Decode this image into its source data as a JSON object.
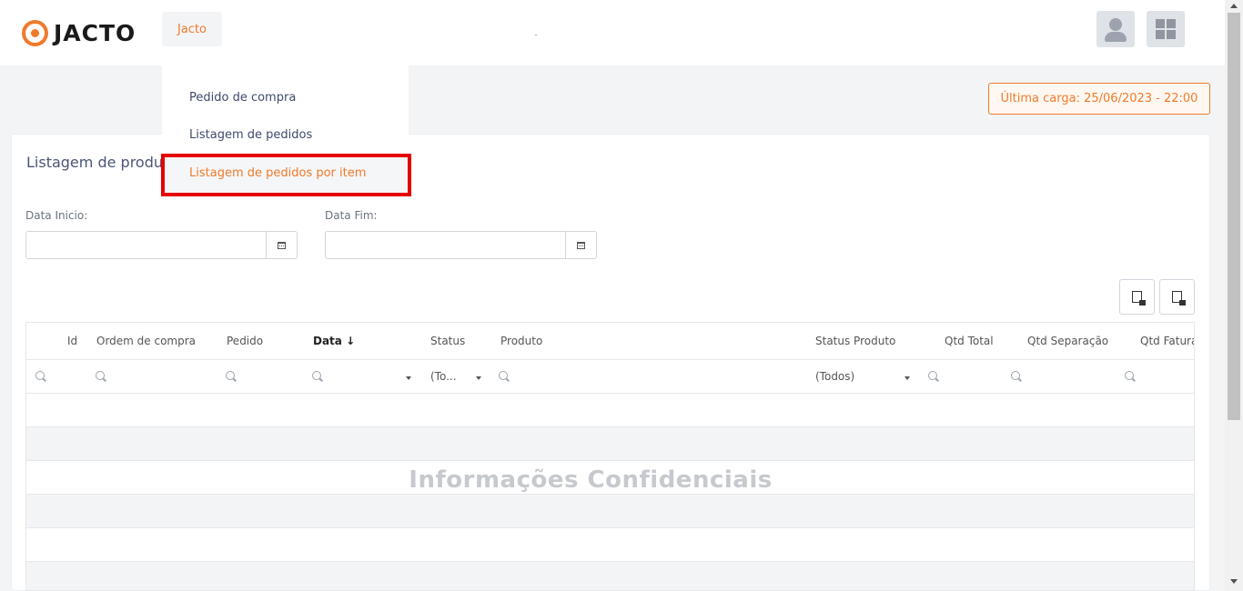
{
  "header": {
    "logo_text": "JACTO",
    "nav_label": "Jacto",
    "icons": [
      "user-icon",
      "apps-grid-icon"
    ]
  },
  "dropdown": {
    "items": [
      {
        "label": "Pedido de compra"
      },
      {
        "label": "Listagem de pedidos"
      },
      {
        "label": "Listagem de pedidos por item"
      }
    ]
  },
  "last_load": "Última carga: 25/06/2023 - 22:00",
  "page_title": "Listagem de produ",
  "filters": {
    "start_label": "Data Inicio:",
    "end_label": "Data Fim:",
    "start_value": "",
    "end_value": ""
  },
  "grid": {
    "columns": [
      "Id",
      "Ordem de compra",
      "Pedido",
      "Data ↓",
      "Status",
      "Produto",
      "Status Produto",
      "Qtd Total",
      "Qtd Separação",
      "Qtd Fatura"
    ],
    "status_filter": "(To...",
    "status_produto_filter": "(Todos)"
  },
  "watermark": "Informações Confidenciais",
  "colors": {
    "accent": "#f07a2a",
    "highlight": "#e60000"
  }
}
